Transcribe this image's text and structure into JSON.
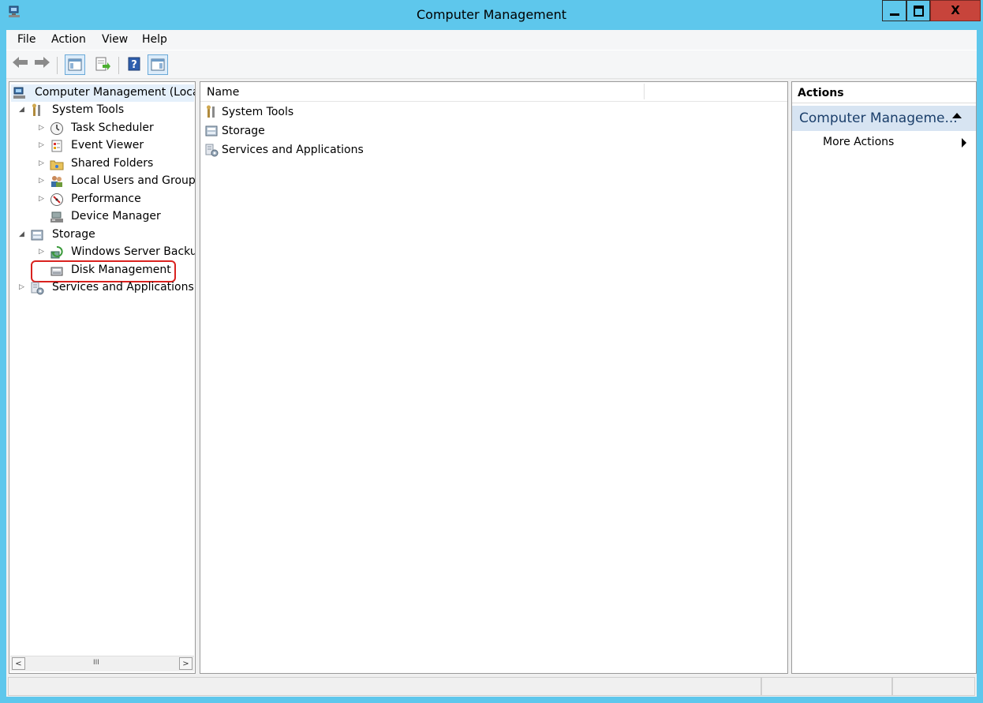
{
  "window": {
    "title": "Computer Management",
    "close_glyph": "X"
  },
  "menu": [
    "File",
    "Action",
    "View",
    "Help"
  ],
  "toolbar": {
    "icons": [
      "back-arrow-icon",
      "forward-arrow-icon",
      "show-hide-console-tree-icon",
      "export-list-icon",
      "help-icon",
      "show-hide-action-pane-icon"
    ]
  },
  "tree": {
    "root": "Computer Management (Local",
    "system_tools": "System Tools",
    "task_scheduler": "Task Scheduler",
    "event_viewer": "Event Viewer",
    "shared_folders": "Shared Folders",
    "local_users": "Local Users and Groups",
    "performance": "Performance",
    "device_manager": "Device Manager",
    "storage": "Storage",
    "wsb": "Windows Server Backup",
    "disk_management": "Disk Management",
    "services_apps": "Services and Applications",
    "scroll_thumb": "III"
  },
  "center": {
    "column_name": "Name",
    "items": [
      "System Tools",
      "Storage",
      "Services and Applications"
    ]
  },
  "actions": {
    "header": "Actions",
    "section": "Computer Manageme...",
    "more": "More Actions"
  },
  "colors": {
    "titlebar": "#5ec7ec",
    "close": "#c7443b",
    "highlight": "#d9221f",
    "action_section": "#d7e4f2"
  }
}
